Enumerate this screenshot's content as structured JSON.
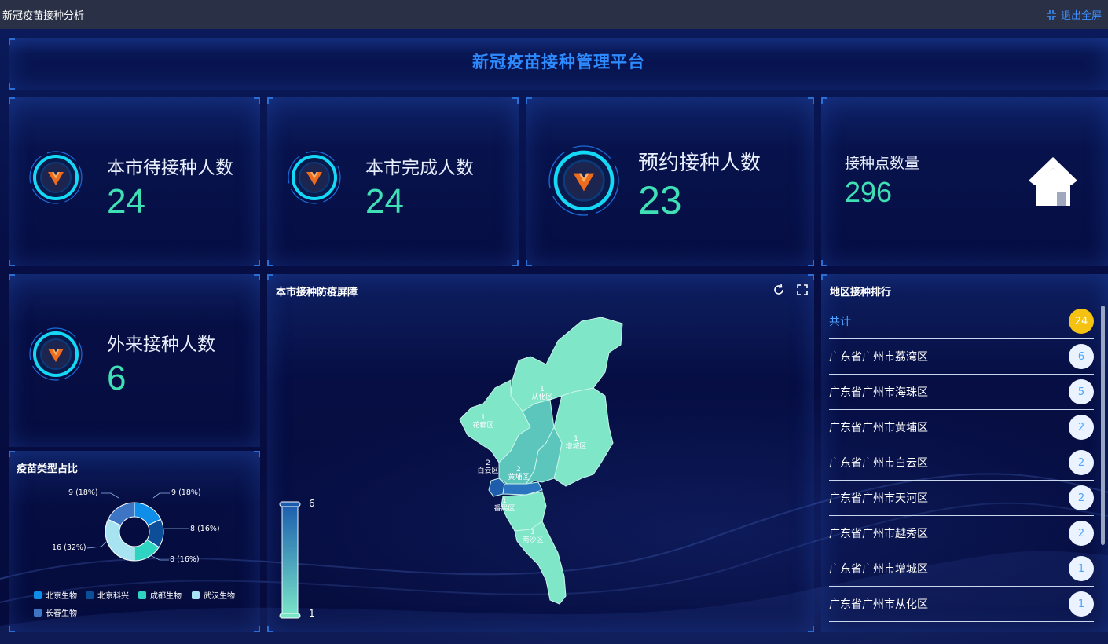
{
  "app": {
    "title": "新冠疫苗接种分析",
    "exit_label": "退出全屏"
  },
  "header": {
    "title": "新冠疫苗接种管理平台"
  },
  "stats": [
    {
      "label": "本市待接种人数",
      "value": "24"
    },
    {
      "label": "本市完成人数",
      "value": "24"
    },
    {
      "label": "预约接种人数",
      "value": "23"
    },
    {
      "label": "接种点数量",
      "value": "296"
    },
    {
      "label": "外来接种人数",
      "value": "6"
    }
  ],
  "map": {
    "title": "本市接种防疫屏障",
    "scale_max": "6",
    "scale_min": "1",
    "regions": [
      {
        "name": "从化区",
        "count": "1"
      },
      {
        "name": "花都区",
        "count": "1"
      },
      {
        "name": "增城区",
        "count": "1"
      },
      {
        "name": "白云区",
        "count": "2"
      },
      {
        "name": "黄埔区",
        "count": "2"
      },
      {
        "name": "番禺区",
        "count": "1"
      },
      {
        "name": "南沙区",
        "count": "1"
      }
    ]
  },
  "pie": {
    "title": "疫苗类型占比",
    "chart_data": {
      "type": "pie",
      "title": "疫苗类型占比",
      "series": [
        {
          "name": "北京生物",
          "value": 9,
          "label": "9 (18%)",
          "color": "#0e8ee8"
        },
        {
          "name": "北京科兴",
          "value": 8,
          "label": "8 (16%)",
          "color": "#0d4e98"
        },
        {
          "name": "成都生物",
          "value": 8,
          "label": "8 (16%)",
          "color": "#2ed3c1"
        },
        {
          "name": "武汉生物",
          "value": 16,
          "label": "16 (32%)",
          "color": "#a8e3f2"
        },
        {
          "name": "长春生物",
          "value": 9,
          "label": "9 (18%)",
          "color": "#3d74c4"
        }
      ],
      "legend": "bottom"
    }
  },
  "ranking": {
    "title": "地区接种排行",
    "total_label": "共计",
    "total_value": "24",
    "rows": [
      {
        "name": "广东省广州市荔湾区",
        "value": "6"
      },
      {
        "name": "广东省广州市海珠区",
        "value": "5"
      },
      {
        "name": "广东省广州市黄埔区",
        "value": "2"
      },
      {
        "name": "广东省广州市白云区",
        "value": "2"
      },
      {
        "name": "广东省广州市天河区",
        "value": "2"
      },
      {
        "name": "广东省广州市越秀区",
        "value": "2"
      },
      {
        "name": "广东省广州市增城区",
        "value": "1"
      },
      {
        "name": "广东省广州市从化区",
        "value": "1"
      }
    ]
  }
}
